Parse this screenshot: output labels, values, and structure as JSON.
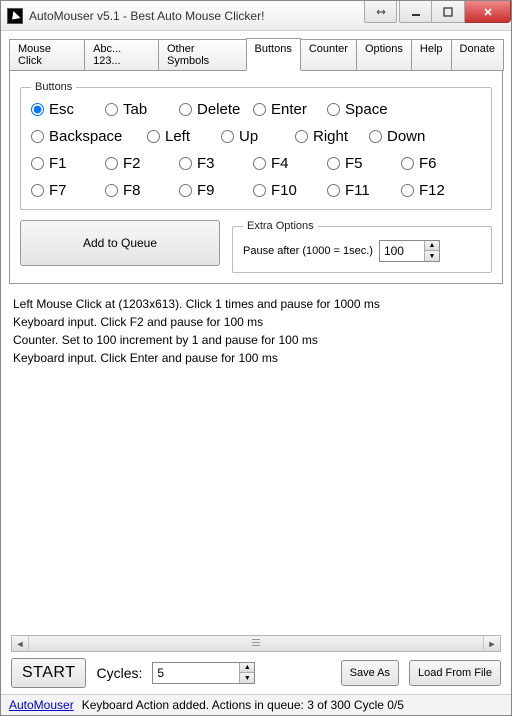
{
  "window": {
    "title": "AutoMouser v5.1 - Best Auto Mouse Clicker!"
  },
  "tabs": {
    "items": [
      {
        "label": "Mouse Click"
      },
      {
        "label": "Abc... 123..."
      },
      {
        "label": "Other Symbols"
      },
      {
        "label": "Buttons"
      },
      {
        "label": "Counter"
      },
      {
        "label": "Options"
      },
      {
        "label": "Help"
      },
      {
        "label": "Donate"
      }
    ],
    "active_index": 3
  },
  "buttons_group": {
    "legend": "Buttons",
    "items": [
      "Esc",
      "Tab",
      "Delete",
      "Enter",
      "Space",
      "Backspace",
      "Left",
      "Up",
      "Right",
      "Down",
      "F1",
      "F2",
      "F3",
      "F4",
      "F5",
      "F6",
      "F7",
      "F8",
      "F9",
      "F10",
      "F11",
      "F12"
    ],
    "selected": "Esc"
  },
  "add_to_queue_label": "Add to Queue",
  "extra": {
    "legend": "Extra Options",
    "pause_label": "Pause after (1000 = 1sec.)",
    "pause_value": "100"
  },
  "queue": [
    "Left Mouse Click at  (1203x613). Click 1 times and pause for 1000 ms",
    "Keyboard input. Click F2 and pause for 100 ms",
    "Counter. Set to 100 increment by 1 and pause for 100 ms",
    "Keyboard input. Click Enter and pause for 100 ms"
  ],
  "bottom": {
    "start": "START",
    "cycles_label": "Cycles:",
    "cycles_value": "5",
    "save_as": "Save As",
    "load": "Load From File"
  },
  "status": {
    "link": "AutoMouser",
    "text": "Keyboard Action added. Actions in queue: 3 of 300  Cycle 0/5"
  }
}
